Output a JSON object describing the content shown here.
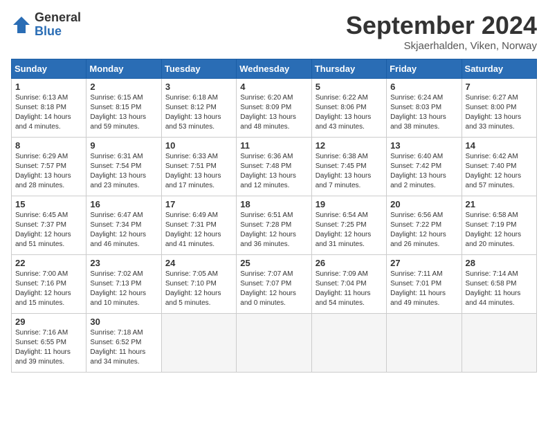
{
  "header": {
    "logo_general": "General",
    "logo_blue": "Blue",
    "month_title": "September 2024",
    "location": "Skjaerhalden, Viken, Norway"
  },
  "weekdays": [
    "Sunday",
    "Monday",
    "Tuesday",
    "Wednesday",
    "Thursday",
    "Friday",
    "Saturday"
  ],
  "weeks": [
    [
      {
        "day": "1",
        "info": "Sunrise: 6:13 AM\nSunset: 8:18 PM\nDaylight: 14 hours\nand 4 minutes."
      },
      {
        "day": "2",
        "info": "Sunrise: 6:15 AM\nSunset: 8:15 PM\nDaylight: 13 hours\nand 59 minutes."
      },
      {
        "day": "3",
        "info": "Sunrise: 6:18 AM\nSunset: 8:12 PM\nDaylight: 13 hours\nand 53 minutes."
      },
      {
        "day": "4",
        "info": "Sunrise: 6:20 AM\nSunset: 8:09 PM\nDaylight: 13 hours\nand 48 minutes."
      },
      {
        "day": "5",
        "info": "Sunrise: 6:22 AM\nSunset: 8:06 PM\nDaylight: 13 hours\nand 43 minutes."
      },
      {
        "day": "6",
        "info": "Sunrise: 6:24 AM\nSunset: 8:03 PM\nDaylight: 13 hours\nand 38 minutes."
      },
      {
        "day": "7",
        "info": "Sunrise: 6:27 AM\nSunset: 8:00 PM\nDaylight: 13 hours\nand 33 minutes."
      }
    ],
    [
      {
        "day": "8",
        "info": "Sunrise: 6:29 AM\nSunset: 7:57 PM\nDaylight: 13 hours\nand 28 minutes."
      },
      {
        "day": "9",
        "info": "Sunrise: 6:31 AM\nSunset: 7:54 PM\nDaylight: 13 hours\nand 23 minutes."
      },
      {
        "day": "10",
        "info": "Sunrise: 6:33 AM\nSunset: 7:51 PM\nDaylight: 13 hours\nand 17 minutes."
      },
      {
        "day": "11",
        "info": "Sunrise: 6:36 AM\nSunset: 7:48 PM\nDaylight: 13 hours\nand 12 minutes."
      },
      {
        "day": "12",
        "info": "Sunrise: 6:38 AM\nSunset: 7:45 PM\nDaylight: 13 hours\nand 7 minutes."
      },
      {
        "day": "13",
        "info": "Sunrise: 6:40 AM\nSunset: 7:42 PM\nDaylight: 13 hours\nand 2 minutes."
      },
      {
        "day": "14",
        "info": "Sunrise: 6:42 AM\nSunset: 7:40 PM\nDaylight: 12 hours\nand 57 minutes."
      }
    ],
    [
      {
        "day": "15",
        "info": "Sunrise: 6:45 AM\nSunset: 7:37 PM\nDaylight: 12 hours\nand 51 minutes."
      },
      {
        "day": "16",
        "info": "Sunrise: 6:47 AM\nSunset: 7:34 PM\nDaylight: 12 hours\nand 46 minutes."
      },
      {
        "day": "17",
        "info": "Sunrise: 6:49 AM\nSunset: 7:31 PM\nDaylight: 12 hours\nand 41 minutes."
      },
      {
        "day": "18",
        "info": "Sunrise: 6:51 AM\nSunset: 7:28 PM\nDaylight: 12 hours\nand 36 minutes."
      },
      {
        "day": "19",
        "info": "Sunrise: 6:54 AM\nSunset: 7:25 PM\nDaylight: 12 hours\nand 31 minutes."
      },
      {
        "day": "20",
        "info": "Sunrise: 6:56 AM\nSunset: 7:22 PM\nDaylight: 12 hours\nand 26 minutes."
      },
      {
        "day": "21",
        "info": "Sunrise: 6:58 AM\nSunset: 7:19 PM\nDaylight: 12 hours\nand 20 minutes."
      }
    ],
    [
      {
        "day": "22",
        "info": "Sunrise: 7:00 AM\nSunset: 7:16 PM\nDaylight: 12 hours\nand 15 minutes."
      },
      {
        "day": "23",
        "info": "Sunrise: 7:02 AM\nSunset: 7:13 PM\nDaylight: 12 hours\nand 10 minutes."
      },
      {
        "day": "24",
        "info": "Sunrise: 7:05 AM\nSunset: 7:10 PM\nDaylight: 12 hours\nand 5 minutes."
      },
      {
        "day": "25",
        "info": "Sunrise: 7:07 AM\nSunset: 7:07 PM\nDaylight: 12 hours\nand 0 minutes."
      },
      {
        "day": "26",
        "info": "Sunrise: 7:09 AM\nSunset: 7:04 PM\nDaylight: 11 hours\nand 54 minutes."
      },
      {
        "day": "27",
        "info": "Sunrise: 7:11 AM\nSunset: 7:01 PM\nDaylight: 11 hours\nand 49 minutes."
      },
      {
        "day": "28",
        "info": "Sunrise: 7:14 AM\nSunset: 6:58 PM\nDaylight: 11 hours\nand 44 minutes."
      }
    ],
    [
      {
        "day": "29",
        "info": "Sunrise: 7:16 AM\nSunset: 6:55 PM\nDaylight: 11 hours\nand 39 minutes."
      },
      {
        "day": "30",
        "info": "Sunrise: 7:18 AM\nSunset: 6:52 PM\nDaylight: 11 hours\nand 34 minutes."
      },
      {
        "day": "",
        "info": ""
      },
      {
        "day": "",
        "info": ""
      },
      {
        "day": "",
        "info": ""
      },
      {
        "day": "",
        "info": ""
      },
      {
        "day": "",
        "info": ""
      }
    ]
  ]
}
